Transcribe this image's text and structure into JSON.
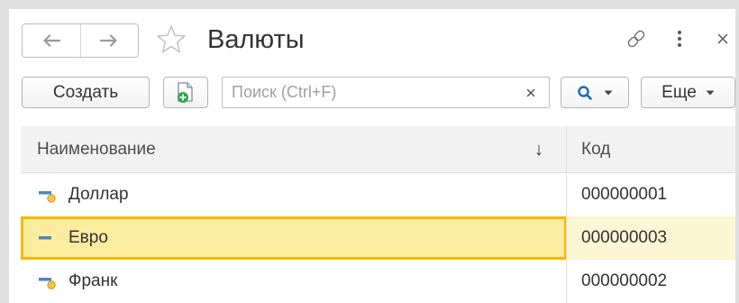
{
  "header": {
    "title": "Валюты",
    "back_icon": "arrow-left-icon",
    "forward_icon": "arrow-right-icon",
    "favorite_icon": "star-icon",
    "link_icon": "link-icon",
    "more_icon": "vertical-dots-icon",
    "close_icon": "close-icon"
  },
  "toolbar": {
    "create_label": "Создать",
    "copy_icon": "add-document-icon",
    "search": {
      "placeholder": "Поиск (Ctrl+F)",
      "value": ""
    },
    "clear_icon": "close-icon",
    "search_menu_icon": "search-icon",
    "more_label": "Еще",
    "accent_color": "#1a6bb8"
  },
  "table": {
    "columns": [
      {
        "label": "Наименование",
        "sort_indicator": "↓"
      },
      {
        "label": "Код"
      }
    ],
    "rows": [
      {
        "name": "Доллар",
        "code": "000000001",
        "selected": false,
        "icon": "catalog-item-icon"
      },
      {
        "name": "Евро",
        "code": "000000003",
        "selected": true,
        "icon": "catalog-item-icon"
      },
      {
        "name": "Франк",
        "code": "000000002",
        "selected": false,
        "icon": "catalog-item-icon"
      }
    ],
    "selection_color": "#fbec9e",
    "selection_border": "#f5b800"
  }
}
